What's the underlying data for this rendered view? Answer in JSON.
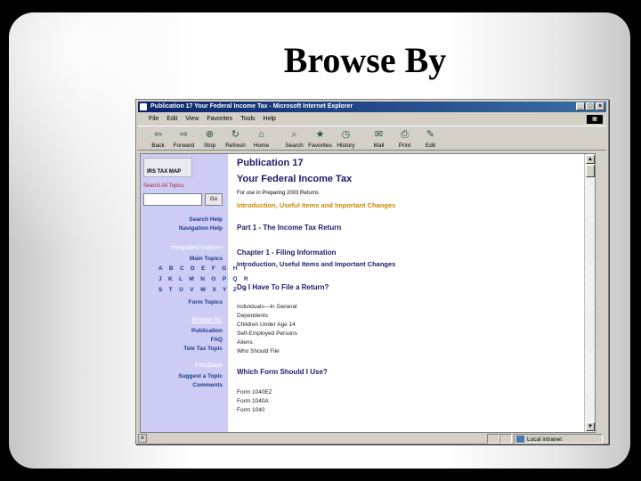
{
  "slide": {
    "title": "Browse By"
  },
  "window": {
    "title": "Publication 17  Your Federal Income Tax - Microsoft Internet Explorer",
    "buttons": {
      "minimize": "_",
      "maximize": "□",
      "close": "×"
    }
  },
  "menu": [
    "File",
    "Edit",
    "View",
    "Favorites",
    "Tools",
    "Help"
  ],
  "toolbar": [
    {
      "label": "Back",
      "icon": "back-arrow-icon",
      "glyph": "⇦"
    },
    {
      "label": "Forward",
      "icon": "forward-arrow-icon",
      "glyph": "⇨"
    },
    {
      "label": "Stop",
      "icon": "stop-icon",
      "glyph": "⊗"
    },
    {
      "label": "Refresh",
      "icon": "refresh-icon",
      "glyph": "↻"
    },
    {
      "label": "Home",
      "icon": "home-icon",
      "glyph": "⌂"
    },
    {
      "label": "Search",
      "icon": "search-icon",
      "glyph": "⌕"
    },
    {
      "label": "Favorites",
      "icon": "favorites-icon",
      "glyph": "★"
    },
    {
      "label": "History",
      "icon": "history-icon",
      "glyph": "◷"
    },
    {
      "label": "Mail",
      "icon": "mail-icon",
      "glyph": "✉"
    },
    {
      "label": "Print",
      "icon": "print-icon",
      "glyph": "⎙"
    },
    {
      "label": "Edit",
      "icon": "edit-icon",
      "glyph": "✎"
    }
  ],
  "nav": {
    "logo": "IRS TAX MAP",
    "search_label": "Search All Topics",
    "search_button": "Go",
    "search_help": "Search Help",
    "navigation_help": "Navigation Help",
    "integrated_indexes": "Integrated Indexes",
    "main_topics": "Main Topics",
    "alpha_rows": [
      "A B C D E F G H I",
      "J K L M N O P Q R",
      "S T U V W X Y Z #"
    ],
    "form_topics": "Form Topics",
    "browse_by": "Browse by:",
    "publication": "Publication",
    "faq": "FAQ",
    "tele_tax": "Tele Tax Topic",
    "feedback": "Feedback",
    "suggest": "Suggest a Topic",
    "comments": "Comments"
  },
  "main": {
    "title1": "Publication 17",
    "title2": "Your Federal Income Tax",
    "subtitle": "For use in Preparing 2003 Returns",
    "intro_link": "Introduction, Useful Items and Important Changes",
    "part1": "Part 1 - The Income Tax Return",
    "chapter1": "Chapter 1 - Filing Information",
    "chapter1_link": "Introduction, Useful Items and Important Changes",
    "q1": "Do I Have To File a Return?",
    "q1_items": [
      "Individuals—In General",
      "Dependents",
      "Children Under Age 14",
      "Self-Employed Persons",
      "Aliens",
      "Who Should File"
    ],
    "q2": "Which Form Should I Use?",
    "q2_items": [
      "Form 1040EZ",
      "Form 1040A",
      "Form 1040"
    ]
  },
  "status": {
    "zone": "Local intranet",
    "page_icon": "e"
  }
}
